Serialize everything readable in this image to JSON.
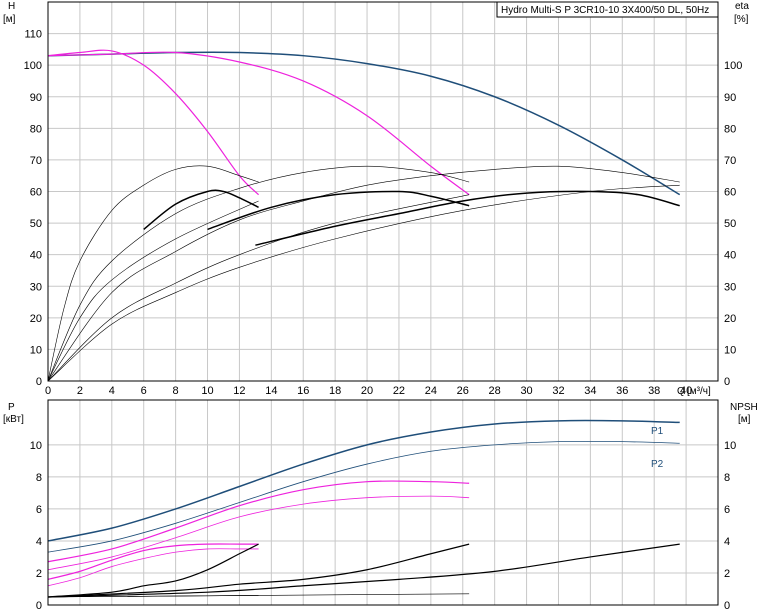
{
  "title": "Hydro Multi-S P 3CR10-10 3X400/50 DL, 50Hz",
  "colors": {
    "blue": "#1f4e79",
    "magenta": "#ee22dd",
    "black": "#000000",
    "grid": "#c8c8c8"
  },
  "chart_data": [
    {
      "type": "line",
      "panel": "upper",
      "title": "Hydro Multi-S P 3CR10-10 3X400/50 DL, 50Hz",
      "y_left_label": "H",
      "y_left_unit": "[м]",
      "y_right_label": "eta",
      "y_right_unit": "[%]",
      "x_label": "Q",
      "x_unit": "[м³/ч]",
      "xlim": [
        0,
        42
      ],
      "ylim": [
        0,
        120
      ],
      "x_ticks": [
        0,
        2,
        4,
        6,
        8,
        10,
        12,
        14,
        16,
        18,
        20,
        22,
        24,
        26,
        28,
        30,
        32,
        34,
        36,
        38,
        40
      ],
      "y_left_ticks": [
        0,
        10,
        20,
        30,
        40,
        50,
        60,
        70,
        80,
        90,
        100,
        110
      ],
      "y_right_ticks": [
        0,
        10,
        20,
        30,
        40,
        50,
        60,
        70,
        80,
        90,
        100
      ],
      "grid": true,
      "series": [
        {
          "color": "blue",
          "width": 1.5,
          "x": [
            0,
            4,
            8,
            12,
            16,
            20,
            24,
            28,
            32,
            36,
            39.6
          ],
          "y": [
            103,
            103.5,
            104,
            104,
            103,
            100.5,
            96.5,
            90,
            81,
            70,
            59
          ]
        },
        {
          "color": "magenta",
          "width": 1.2,
          "x": [
            0,
            4,
            8,
            12,
            16,
            20,
            24,
            26.4
          ],
          "y": [
            103,
            103.5,
            104,
            101,
            95,
            84,
            68,
            59
          ]
        },
        {
          "color": "magenta",
          "width": 1.2,
          "x": [
            0,
            2,
            4,
            6,
            8,
            10,
            12,
            13.2
          ],
          "y": [
            103,
            104,
            104.5,
            100,
            91,
            79,
            65,
            59
          ]
        },
        {
          "color": "black",
          "width": 0.6,
          "x": [
            0,
            1,
            2,
            4,
            6,
            8,
            10,
            12,
            13.2
          ],
          "y": [
            0,
            23,
            38,
            54,
            62,
            67,
            68,
            65,
            63
          ]
        },
        {
          "color": "black",
          "width": 0.6,
          "x": [
            0,
            2,
            4,
            8,
            12,
            16,
            20,
            24,
            26.4
          ],
          "y": [
            0,
            24,
            38,
            53,
            61,
            66,
            68,
            66,
            63
          ]
        },
        {
          "color": "black",
          "width": 0.6,
          "x": [
            0,
            4,
            8,
            12,
            16,
            20,
            24,
            28,
            32,
            36,
            39.6
          ],
          "y": [
            0,
            28,
            41,
            51,
            57,
            62,
            65,
            67,
            68,
            66,
            63
          ]
        },
        {
          "color": "black",
          "width": 0.6,
          "x": [
            0,
            2,
            4,
            8,
            13.2
          ],
          "y": [
            0,
            20,
            32,
            45,
            57
          ]
        },
        {
          "color": "black",
          "width": 0.6,
          "x": [
            0,
            4,
            8,
            12,
            18,
            26.4
          ],
          "y": [
            0,
            20,
            31,
            40,
            50,
            59
          ]
        },
        {
          "color": "black",
          "width": 0.6,
          "x": [
            0,
            4,
            8,
            12,
            18,
            26,
            34,
            39.6
          ],
          "y": [
            0,
            18,
            28,
            36,
            45,
            54,
            60,
            62
          ]
        },
        {
          "color": "black",
          "width": 1.5,
          "x": [
            6,
            8,
            10,
            11,
            12,
            13.2
          ],
          "y": [
            48,
            56,
            60,
            60,
            58,
            55
          ]
        },
        {
          "color": "black",
          "width": 1.5,
          "x": [
            10,
            14,
            18,
            22,
            24,
            26.4
          ],
          "y": [
            48,
            55,
            59,
            60,
            58.5,
            55.5
          ]
        },
        {
          "color": "black",
          "width": 1.5,
          "x": [
            13,
            18,
            22,
            26,
            30,
            34,
            37,
            39.6
          ],
          "y": [
            43,
            49,
            53,
            57,
            59.5,
            60,
            59,
            55.5
          ]
        }
      ]
    },
    {
      "type": "line",
      "panel": "lower",
      "y_left_label": "P",
      "y_left_unit": "[кВт]",
      "y_right_label": "NPSH",
      "y_right_unit": "[м]",
      "xlim": [
        0,
        42
      ],
      "ylim": [
        0,
        12.8
      ],
      "y_left_ticks": [
        0,
        2,
        4,
        6,
        8,
        10
      ],
      "y_right_ticks": [
        0,
        2,
        4,
        6,
        8,
        10
      ],
      "grid": true,
      "series": [
        {
          "name": "P1",
          "color": "blue",
          "width": 1.5,
          "x": [
            0,
            4,
            8,
            12,
            16,
            20,
            24,
            28,
            32,
            36,
            39.6
          ],
          "y": [
            4,
            4.8,
            6,
            7.4,
            8.8,
            10,
            10.8,
            11.3,
            11.5,
            11.5,
            11.4
          ]
        },
        {
          "name": "P2",
          "color": "blue",
          "width": 0.8,
          "x": [
            0,
            4,
            8,
            12,
            16,
            20,
            24,
            28,
            32,
            36,
            39.6
          ],
          "y": [
            3.3,
            4,
            5.1,
            6.4,
            7.7,
            8.8,
            9.6,
            10,
            10.2,
            10.2,
            10.1
          ]
        },
        {
          "color": "magenta",
          "width": 1.2,
          "x": [
            0,
            4,
            8,
            12,
            16,
            20,
            24,
            26.4
          ],
          "y": [
            2.7,
            3.5,
            4.8,
            6.2,
            7.2,
            7.7,
            7.7,
            7.6
          ]
        },
        {
          "color": "magenta",
          "width": 0.8,
          "x": [
            0,
            4,
            8,
            12,
            16,
            20,
            24,
            26.4
          ],
          "y": [
            2.2,
            3,
            4.2,
            5.5,
            6.3,
            6.7,
            6.8,
            6.7
          ]
        },
        {
          "color": "magenta",
          "width": 1.2,
          "x": [
            0,
            2,
            4,
            6,
            8,
            10,
            12,
            13.2
          ],
          "y": [
            1.6,
            2.1,
            2.8,
            3.4,
            3.7,
            3.8,
            3.8,
            3.8
          ]
        },
        {
          "color": "magenta",
          "width": 0.8,
          "x": [
            0,
            2,
            4,
            6,
            8,
            10,
            12,
            13.2
          ],
          "y": [
            1.2,
            1.7,
            2.4,
            2.9,
            3.3,
            3.5,
            3.5,
            3.5
          ]
        },
        {
          "color": "black",
          "width": 1.2,
          "x": [
            0,
            4,
            6,
            8,
            10,
            12,
            13.2
          ],
          "y": [
            0.5,
            0.8,
            1.2,
            1.5,
            2.2,
            3.2,
            3.8
          ]
        },
        {
          "color": "black",
          "width": 1.2,
          "x": [
            0,
            8,
            12,
            16,
            20,
            24,
            26.4
          ],
          "y": [
            0.5,
            0.9,
            1.3,
            1.6,
            2.2,
            3.2,
            3.8
          ]
        },
        {
          "color": "black",
          "width": 1.2,
          "x": [
            0,
            10,
            16,
            22,
            28,
            34,
            39.6
          ],
          "y": [
            0.5,
            0.8,
            1.2,
            1.6,
            2.1,
            3,
            3.8
          ]
        },
        {
          "color": "black",
          "width": 0.6,
          "x": [
            0,
            13.2
          ],
          "y": [
            0.5,
            0.6
          ]
        },
        {
          "color": "black",
          "width": 0.6,
          "x": [
            0,
            26.4
          ],
          "y": [
            0.5,
            0.7
          ]
        }
      ]
    }
  ]
}
